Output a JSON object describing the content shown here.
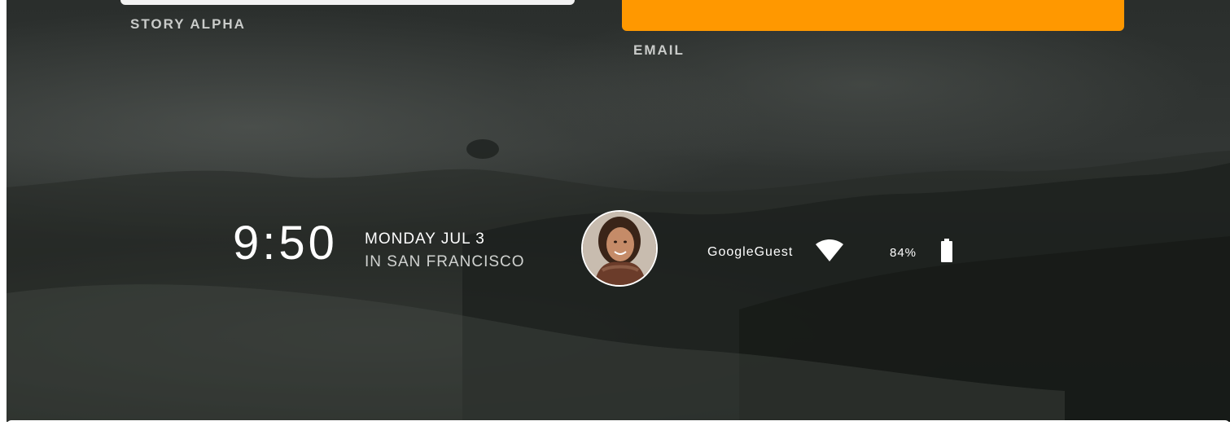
{
  "cards": {
    "left_label": "STORY ALPHA",
    "right_label": "EMAIL",
    "right_color": "#ff9800"
  },
  "lockscreen": {
    "time": "9:50",
    "date": "MONDAY JUL 3",
    "location": "IN SAN FRANCISCO",
    "avatar_icon": "user-avatar",
    "network_name": "GoogleGuest",
    "wifi_icon": "wifi-icon",
    "battery_percent": "84%",
    "battery_level": 0.84,
    "battery_icon": "battery-icon"
  }
}
